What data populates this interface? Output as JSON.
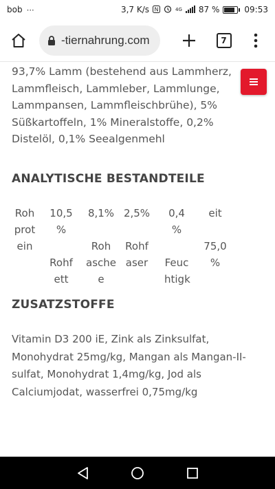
{
  "status_bar": {
    "carrier": "bob",
    "net_speed": "3,7 K/s",
    "network_type": "4G",
    "battery_percent": "87 %",
    "battery_level": 0.87,
    "time": "09:53"
  },
  "browser": {
    "url": "-tiernahrung.com",
    "tab_count": "7",
    "icons": [
      "home-icon",
      "lock-icon",
      "new-tab-icon",
      "tab-switcher-icon",
      "more-menu-icon"
    ]
  },
  "page": {
    "ingredients_text": "93,7% Lamm (bestehend aus Lammherz, Lammfleisch, Lammleber, Lammlunge, Lammpansen, Lammfleischbrühe), 5% Süßkartoffeln, 1% Mineralstoffe, 0,2% Distelöl, 0,1% Seealgenmehl",
    "analytic_heading": "ANALYTISCHE BESTANDTEILE",
    "analytic_columns": [
      {
        "lines": [
          "Roh",
          "prot",
          "ein"
        ]
      },
      {
        "lines": [
          "10,5",
          "%",
          "",
          "Rohf",
          "ett"
        ]
      },
      {
        "lines": [
          "8,1%",
          "",
          "Roh",
          "asche",
          "e"
        ]
      },
      {
        "lines": [
          "2,5%",
          "",
          "Rohf",
          "aser"
        ]
      },
      {
        "lines": [
          "0,4",
          "%",
          "",
          "Feuc",
          "htigk"
        ]
      },
      {
        "lines": [
          "eit",
          "",
          "75,0",
          "%"
        ]
      }
    ],
    "additives_heading": "ZUSATZSTOFFE",
    "additives_text": "Vitamin D3 200 iE, Zink als Zinksulfat, Monohydrat 25mg/kg, Mangan als Mangan-II-sulfat, Monohydrat 1,4mg/kg, Jod als Calciumjodat, wasserfrei 0,75mg/kg"
  },
  "colors": {
    "accent_red": "#e3192c",
    "text": "#555555",
    "nav_bar": "#000000"
  }
}
